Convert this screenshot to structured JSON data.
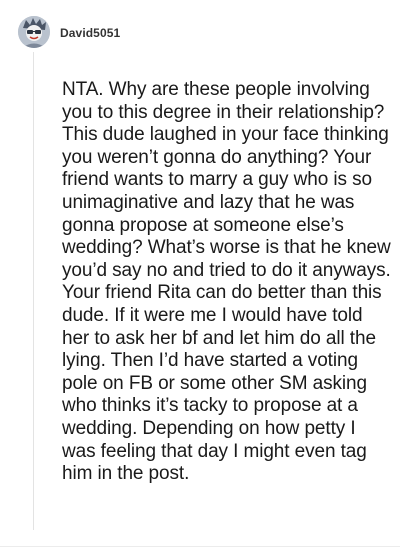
{
  "comment": {
    "author": "David5051",
    "body": "NTA. Why are these people involving you to this degree in their relationship? This dude laughed in your face thinking you weren’t gonna do anything? Your friend wants to marry a guy who is so unimaginative and lazy that he was gonna propose at someone else’s wedding? What’s worse is that he knew you’d say no and tried to do it anyways. Your friend Rita can do better than this dude. If it were me I would have told her to ask her bf and let him do all the lying. Then I’d have started a voting pole on FB or some other SM asking who thinks it’s tacky to propose at a wedding. Depending on how petty I was feeling that day I might even tag him in the post."
  },
  "colors": {
    "text": "#1a1a1a",
    "username": "#333333",
    "thread_line": "#e3e3e3"
  }
}
